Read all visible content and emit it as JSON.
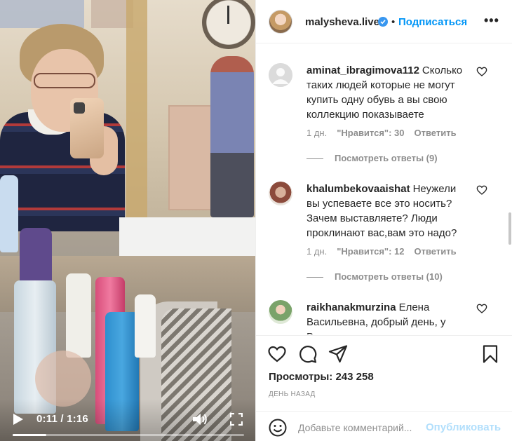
{
  "video": {
    "time": "0:11 / 1:16",
    "progress": 0.145,
    "icons": [
      "play-icon",
      "volume-icon",
      "fullscreen-icon"
    ]
  },
  "header": {
    "username": "malysheva.live",
    "dot": "•",
    "follow_label": "Подписаться",
    "more_label": "•••"
  },
  "comments": [
    {
      "username": "aminat_ibragimova112",
      "text": "Сколько таких людей которые не могут купить одну обувь а вы свою коллекцию показываете",
      "age": "1 дн.",
      "likes": "\"Нравится\": 30",
      "reply": "Ответить",
      "view_replies": "Посмотреть ответы (9)"
    },
    {
      "username": "khalumbekovaaishat",
      "text": "Неужели вы успеваете все это носить? Зачем выставляете? Люди проклинают вас,вам это надо?",
      "age": "1 дн.",
      "likes": "\"Нравится\": 12",
      "reply": "Ответить",
      "view_replies": "Посмотреть ответы (10)"
    },
    {
      "username": "raikhanakmurzina",
      "text": "Елена Васильевна, добрый день, у Вас"
    }
  ],
  "actions": {
    "icons": [
      "heart-icon",
      "comment-icon",
      "share-icon",
      "bookmark-icon"
    ],
    "views_label": "Просмотры:",
    "views_count": "243 258",
    "date": "ДЕНЬ НАЗАД"
  },
  "add_comment": {
    "placeholder": "Добавьте комментарий...",
    "publish_label": "Опубликовать"
  },
  "colors": {
    "accent": "#0095f6",
    "publish_disabled": "#b2dffc",
    "meta_text": "#8e8e8e",
    "verified": "#3897f0"
  }
}
